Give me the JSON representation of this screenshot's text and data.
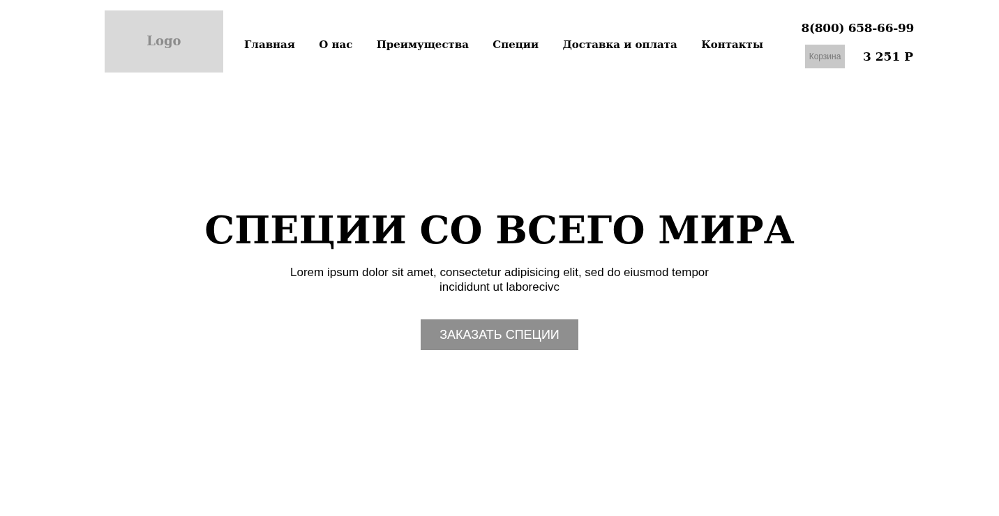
{
  "header": {
    "logo": "Logo",
    "nav": [
      "Главная",
      "О нас",
      "Преимущества",
      "Специи",
      "Доставка и оплата",
      "Контакты"
    ],
    "phone": "8(800) 658-66-99",
    "cart_button": "Корзина",
    "cart_total": "3 251 Р"
  },
  "hero": {
    "title": "СПЕЦИИ СО ВСЕГО МИРА",
    "text": "Lorem ipsum dolor sit amet, consectetur adipisicing elit, sed do eiusmod tempor incididunt ut laborecivc",
    "button": "ЗАКАЗАТЬ СПЕЦИИ"
  }
}
